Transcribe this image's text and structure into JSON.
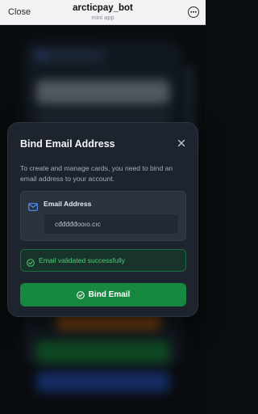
{
  "topbar": {
    "close_label": "Close",
    "bot_name": "arcticpay_bot",
    "subtitle": "mini app",
    "more_icon": "more-icon"
  },
  "modal": {
    "title": "Bind Email Address",
    "description": "To create and manage cards, you need to bind an email address to your account.",
    "email_label": "Email Address",
    "email_value": "cđđđđđooıо.сıс",
    "success_text": "Email validated successfully",
    "bind_button_label": "Bind Email"
  },
  "colors": {
    "accent_green": "#16883f",
    "success_text": "#4fcf7b",
    "modal_bg": "#1e242e"
  }
}
